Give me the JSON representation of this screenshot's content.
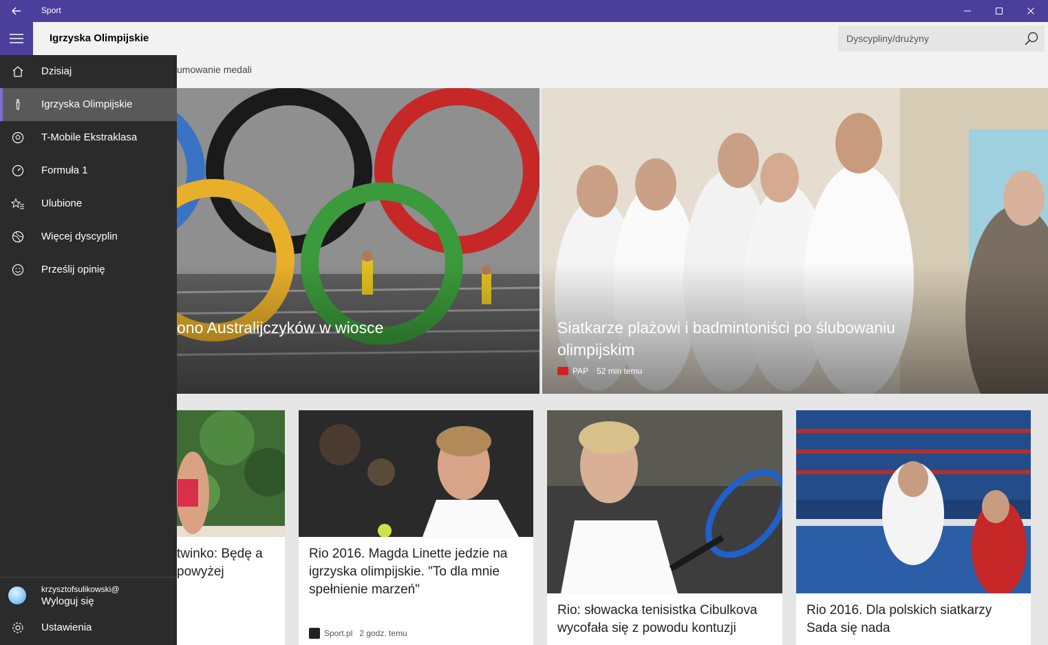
{
  "window": {
    "title": "Sport",
    "controls": {
      "minimize": "–",
      "maximize": "☐",
      "close": "✕"
    }
  },
  "header": {
    "page_title": "Igrzyska Olimpijskie",
    "search_placeholder": "Dyscypliny/drużyny"
  },
  "subnav": {
    "visible_tab": "umowanie medali"
  },
  "sidebar": {
    "items": [
      {
        "label": "Dzisiaj",
        "icon": "home-icon",
        "active": false
      },
      {
        "label": "Igrzyska Olimpijskie",
        "icon": "torch-icon",
        "active": true
      },
      {
        "label": "T-Mobile Ekstraklasa",
        "icon": "soccer-ball-icon",
        "active": false
      },
      {
        "label": "Formuła 1",
        "icon": "speedometer-icon",
        "active": false
      },
      {
        "label": "Ulubione",
        "icon": "star-list-icon",
        "active": false
      },
      {
        "label": "Więcej dyscyplin",
        "icon": "ball-icon",
        "active": false
      },
      {
        "label": "Prześlij opinię",
        "icon": "smiley-icon",
        "active": false
      }
    ],
    "account": {
      "user": "krzysztofsulikowski@",
      "action": "Wyloguj się"
    },
    "settings": {
      "label": "Ustawienia",
      "icon": "gear-icon"
    }
  },
  "hero": [
    {
      "headline": "ono Australijczyków w wiosce"
    },
    {
      "headline": "Siatkarze plażowi i badmintoniści po ślubowaniu olimpijskim",
      "source": "PAP",
      "time": "52 min temu"
    }
  ],
  "cards": [
    {
      "title": "twinko: Będę a powyżej"
    },
    {
      "title": "Rio 2016. Magda Linette jedzie na igrzyska olimpijskie. \"To dla mnie spełnienie marzeń\"",
      "source": "Sport.pl",
      "time": "2 godz. temu"
    },
    {
      "title": "Rio: słowacka tenisistka Cibulkova wycofała się z powodu kontuzji"
    },
    {
      "title": "Rio 2016. Dla polskich siatkarzy Sada się nada"
    }
  ],
  "colors": {
    "accent": "#4b3f9b",
    "sidebar_bg": "#2b2b2b",
    "active_item": "#595959"
  }
}
